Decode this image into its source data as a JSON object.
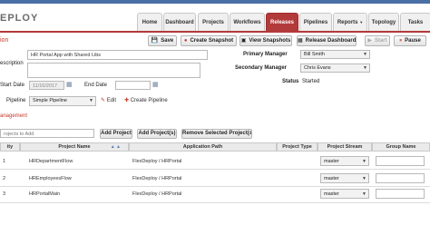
{
  "header": {
    "logo_text": "EPLOY",
    "tabs": [
      "Home",
      "Dashboard",
      "Projects",
      "Workflows",
      "Releases",
      "Pipelines",
      "Reports",
      "Topology",
      "Tasks"
    ],
    "active_tab": "Releases",
    "reports_caret": "▼"
  },
  "section_title": "ion",
  "toolbar": {
    "save": "Save",
    "create_snapshot": "Create Snapshot",
    "view_snapshots": "View Snapshots",
    "release_dashboard": "Release Dashboard",
    "start": "Start",
    "pause": "Pause"
  },
  "form": {
    "name_value": "HR Portal App with Shared Libs",
    "description_label": "escription",
    "start_date_label": "Start Date",
    "start_date_value": "11/16/2017",
    "end_date_label": "End Date",
    "pipeline_label": "Pipeline",
    "pipeline_value": "Simple Pipeline",
    "edit_link": "Edit",
    "create_pipeline_link": "Create Pipeline",
    "primary_manager_label": "Primary Manager",
    "primary_manager_value": "Bill Smith",
    "secondary_manager_label": "Secondary Manager",
    "secondary_manager_value": "Chris Evans",
    "status_label": "Status",
    "status_value": "Started"
  },
  "management_label": "anagement",
  "project_controls": {
    "search_placeholder": "rojects to Add",
    "add_project": "Add Project",
    "add_projects": "Add Project(s)",
    "remove_selected": "Remove Selected Project(s)"
  },
  "table": {
    "headers": [
      "ity",
      "Project Name",
      "Application Path",
      "Project Type",
      "Project Stream",
      "Group Name"
    ],
    "sort_icons": "▲ ▲",
    "rows": [
      {
        "priority": "1",
        "name": "HRDepartmentFlow",
        "path": "FlexDeploy / HRPortal",
        "type": "",
        "stream": "master"
      },
      {
        "priority": "2",
        "name": "HREmployeesFlow",
        "path": "FlexDeploy / HRPortal",
        "type": "",
        "stream": "master"
      },
      {
        "priority": "3",
        "name": "HRPortalMain",
        "path": "FlexDeploy / HRPortal",
        "type": "",
        "stream": "master"
      }
    ]
  },
  "colors": {
    "accent": "#b33a3a",
    "header_blue": "#4a6fa5"
  }
}
